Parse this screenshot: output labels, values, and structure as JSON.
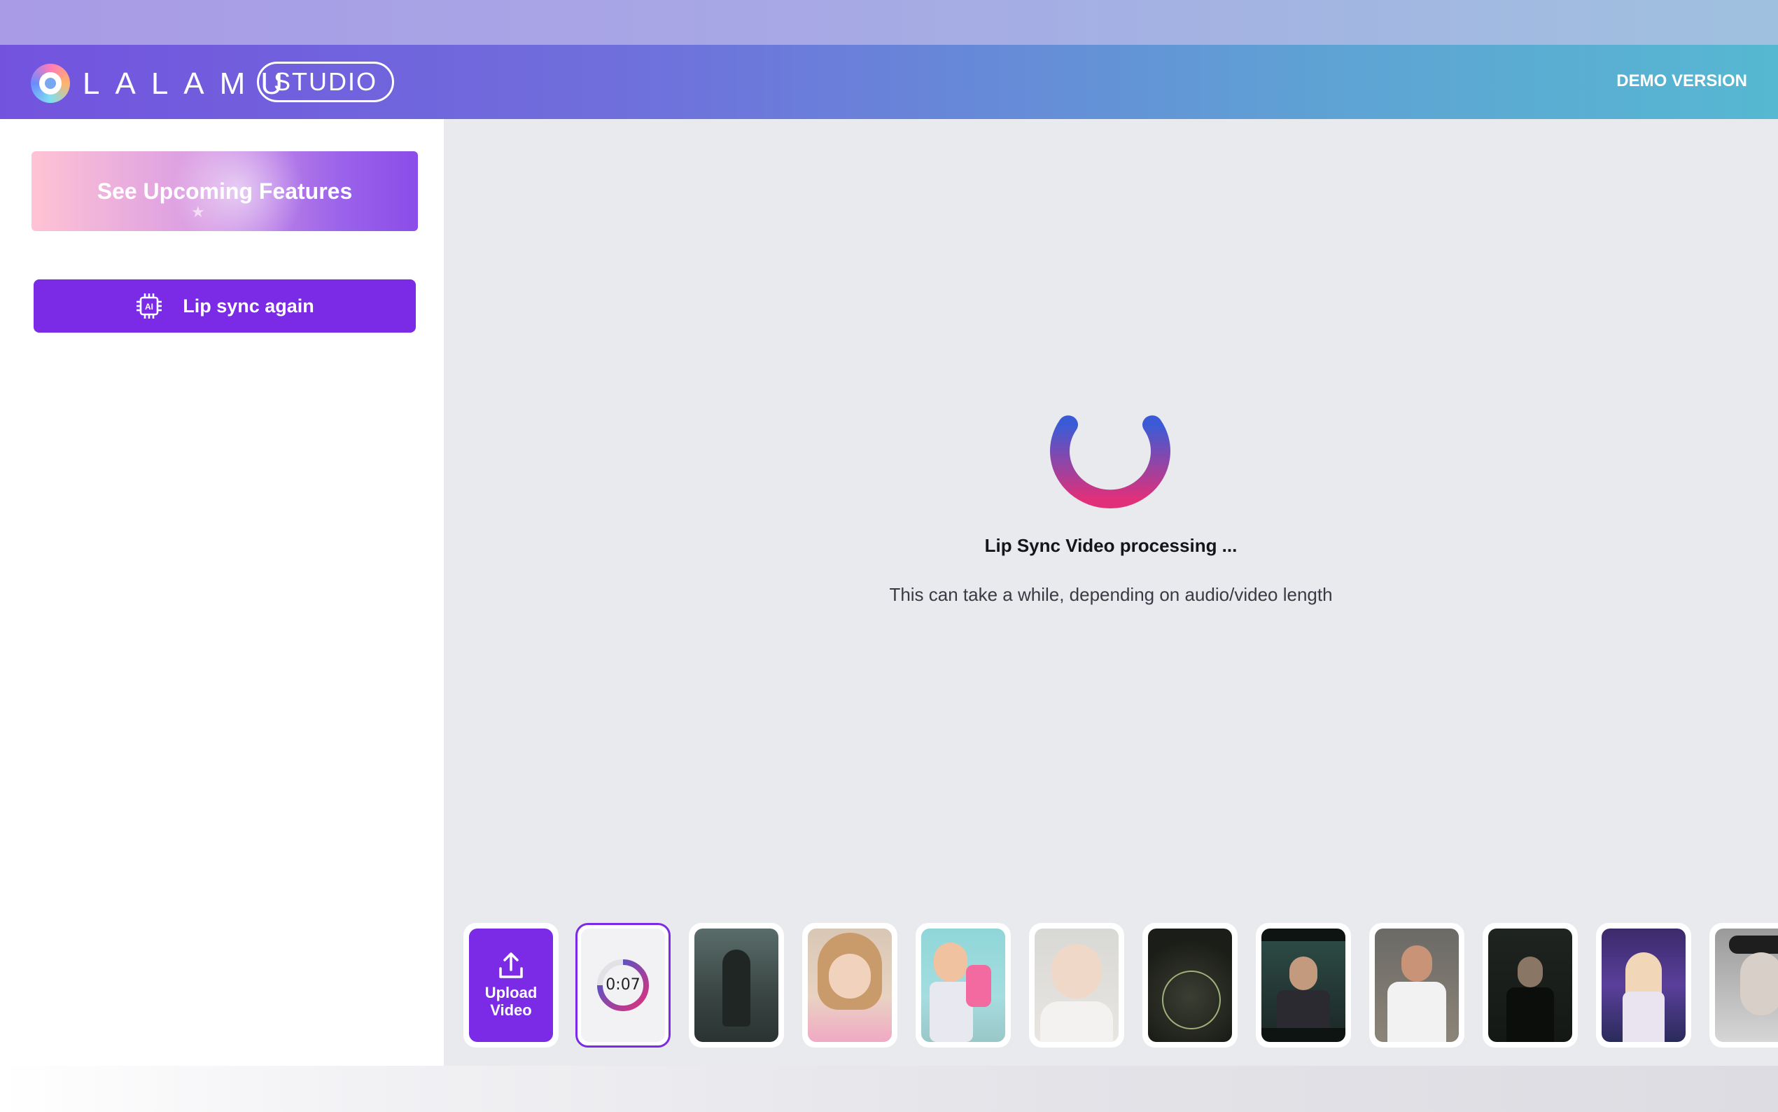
{
  "header": {
    "logo_text": "LALAMU",
    "studio_label": "STUDIO",
    "demo_label": "DEMO VERSION"
  },
  "sidebar": {
    "features_label": "See Upcoming Features",
    "lipsync_label": "Lip sync again",
    "lipsync_icon": "ai-chip-icon"
  },
  "main": {
    "processing_title": "Lip Sync Video processing ...",
    "processing_subtitle": "This can take a while, depending on audio/video length"
  },
  "thumbnails": {
    "upload_label_line1": "Upload",
    "upload_label_line2": "Video",
    "selected_timer": "0:07"
  },
  "colors": {
    "accent": "#7b2ae6",
    "header_start": "#7353de",
    "header_end": "#56b8d1",
    "spinner_start": "#3b5bd6",
    "spinner_end": "#e0307a"
  }
}
